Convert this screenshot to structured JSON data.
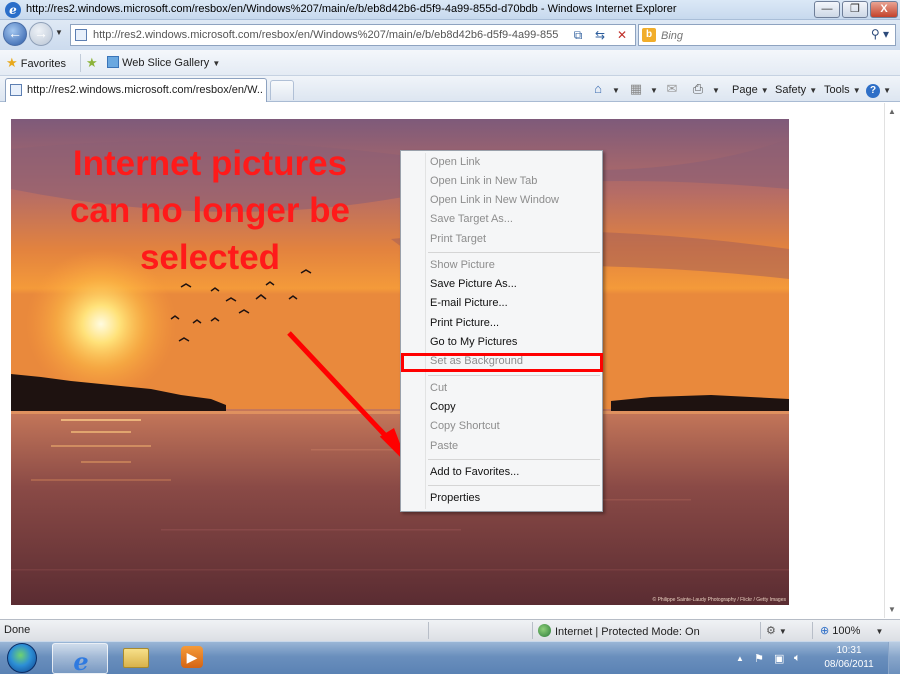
{
  "window": {
    "title": "http://res2.windows.microsoft.com/resbox/en/Windows%207/main/e/b/eb8d42b6-d5f9-4a99-855d-d70bdb - Windows Internet Explorer",
    "minimize": "—",
    "restore": "❐",
    "close": "X"
  },
  "address_bar": {
    "url": "http://res2.windows.microsoft.com/resbox/en/Windows%207/main/e/b/eb8d42b6-d5f9-4a99-855",
    "search_placeholder": "Bing"
  },
  "favorites_bar": {
    "favorites_label": "Favorites",
    "web_slice_label": "Web Slice Gallery"
  },
  "tab": {
    "label": "http://res2.windows.microsoft.com/resbox/en/W..."
  },
  "command_bar": {
    "page": "Page",
    "safety": "Safety",
    "tools": "Tools"
  },
  "annotation": {
    "line1": "Internet pictures",
    "line2": "can no longer be",
    "line3": "selected"
  },
  "photo_credit": "© Philippe Sainte-Laudy Photography / Flickr / Getty Images",
  "context_menu": {
    "items": [
      {
        "label": "Open Link",
        "enabled": false
      },
      {
        "label": "Open Link in New Tab",
        "enabled": false
      },
      {
        "label": "Open Link in New Window",
        "enabled": false
      },
      {
        "label": "Save Target As...",
        "enabled": false
      },
      {
        "label": "Print Target",
        "enabled": false
      },
      {
        "label": "Show Picture",
        "enabled": false
      },
      {
        "label": "Save Picture As...",
        "enabled": true
      },
      {
        "label": "E-mail Picture...",
        "enabled": true
      },
      {
        "label": "Print Picture...",
        "enabled": true
      },
      {
        "label": "Go to My Pictures",
        "enabled": true
      },
      {
        "label": "Set as Background",
        "enabled": false
      },
      {
        "label": "Cut",
        "enabled": false
      },
      {
        "label": "Copy",
        "enabled": true
      },
      {
        "label": "Copy Shortcut",
        "enabled": false
      },
      {
        "label": "Paste",
        "enabled": false
      },
      {
        "label": "Add to Favorites...",
        "enabled": true
      },
      {
        "label": "Properties",
        "enabled": true
      }
    ]
  },
  "status_bar": {
    "status": "Done",
    "zone": "Internet | Protected Mode: On",
    "zoom": "100%"
  },
  "taskbar": {
    "time": "10:31",
    "date": "08/06/2011"
  },
  "colors": {
    "annotation_red": "#ff1a1a",
    "highlight_box": "#ff0000"
  }
}
